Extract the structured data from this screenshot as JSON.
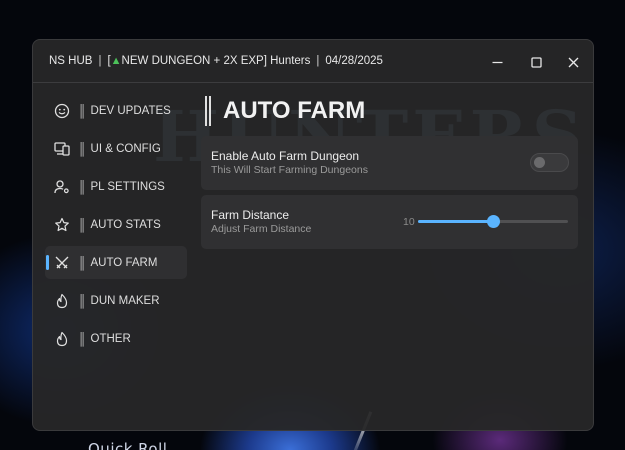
{
  "window": {
    "hub_name": "NS HUB",
    "game_name": "[",
    "game_tree": "▲",
    "game_suffix": "NEW DUNGEON + 2X EXP] Hunters",
    "date": "04/28/2025"
  },
  "sidebar": {
    "accent_color": "#5ab4ff",
    "items": [
      {
        "label": "DEV UPDATES",
        "icon": "smiley-icon"
      },
      {
        "label": "UI & CONFIG",
        "icon": "devices-icon"
      },
      {
        "label": "PL SETTINGS",
        "icon": "user-settings-icon"
      },
      {
        "label": "AUTO STATS",
        "icon": "star-icon"
      },
      {
        "label": "AUTO FARM",
        "icon": "crossed-swords-icon",
        "active": true
      },
      {
        "label": "DUN MAKER",
        "icon": "flame-icon"
      },
      {
        "label": "OTHER",
        "icon": "flame-icon"
      }
    ]
  },
  "main": {
    "title": "AUTO FARM",
    "toggle_card": {
      "title": "Enable Auto Farm Dungeon",
      "subtitle": "This Will Start Farming Dungeons",
      "enabled": false
    },
    "slider_card": {
      "title": "Farm Distance",
      "subtitle": "Adjust Farm Distance",
      "value": "10",
      "fill_fraction": 0.5
    }
  },
  "background": {
    "text": "Quick Roll"
  }
}
